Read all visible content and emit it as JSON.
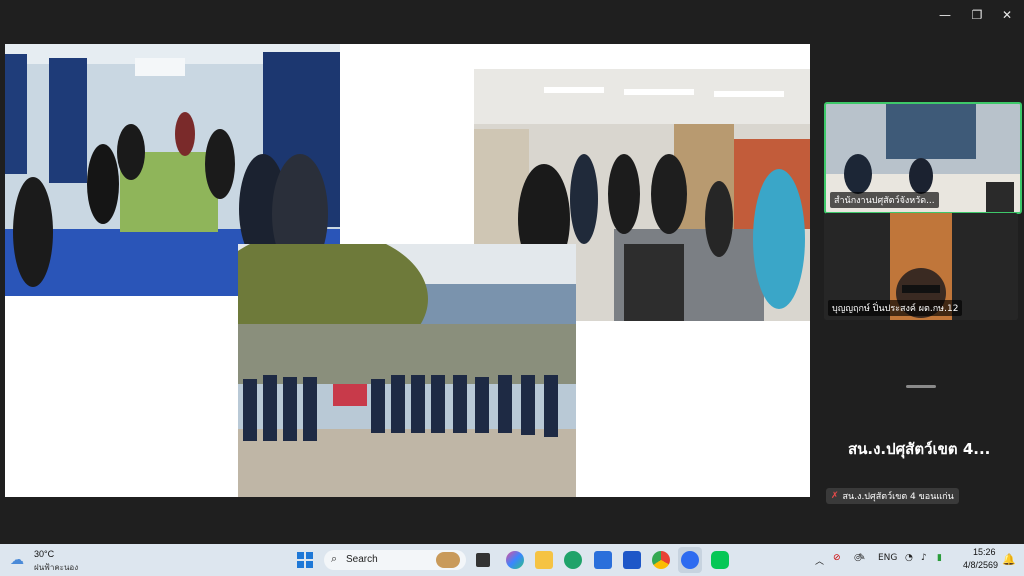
{
  "window": {
    "minimize": "—",
    "restore": "❐",
    "close": "✕"
  },
  "participants": [
    {
      "name": "สำนักงานปศุสัตว์จังหวัด..."
    },
    {
      "name": "บุญญฤกษ์ ปิ่นประสงค์ ผต.กษ.12"
    }
  ],
  "speaker": {
    "title": "สน.ง.ปศุสัตว์เขต 4...",
    "label": "สน.ง.ปศุสัตว์เขต 4 ขอนแก่น"
  },
  "taskbar": {
    "weather_temp": "30°C",
    "weather_desc": "ฝนฟ้าคะนอง",
    "search_placeholder": "Search",
    "language": "ENG",
    "time": "15:26",
    "date": "4/8/2569"
  },
  "icons": [
    "windows-icon",
    "search-icon",
    "file-explorer-icon",
    "edge-icon",
    "store-icon",
    "chrome-icon",
    "zoom-icon",
    "line-icon"
  ]
}
